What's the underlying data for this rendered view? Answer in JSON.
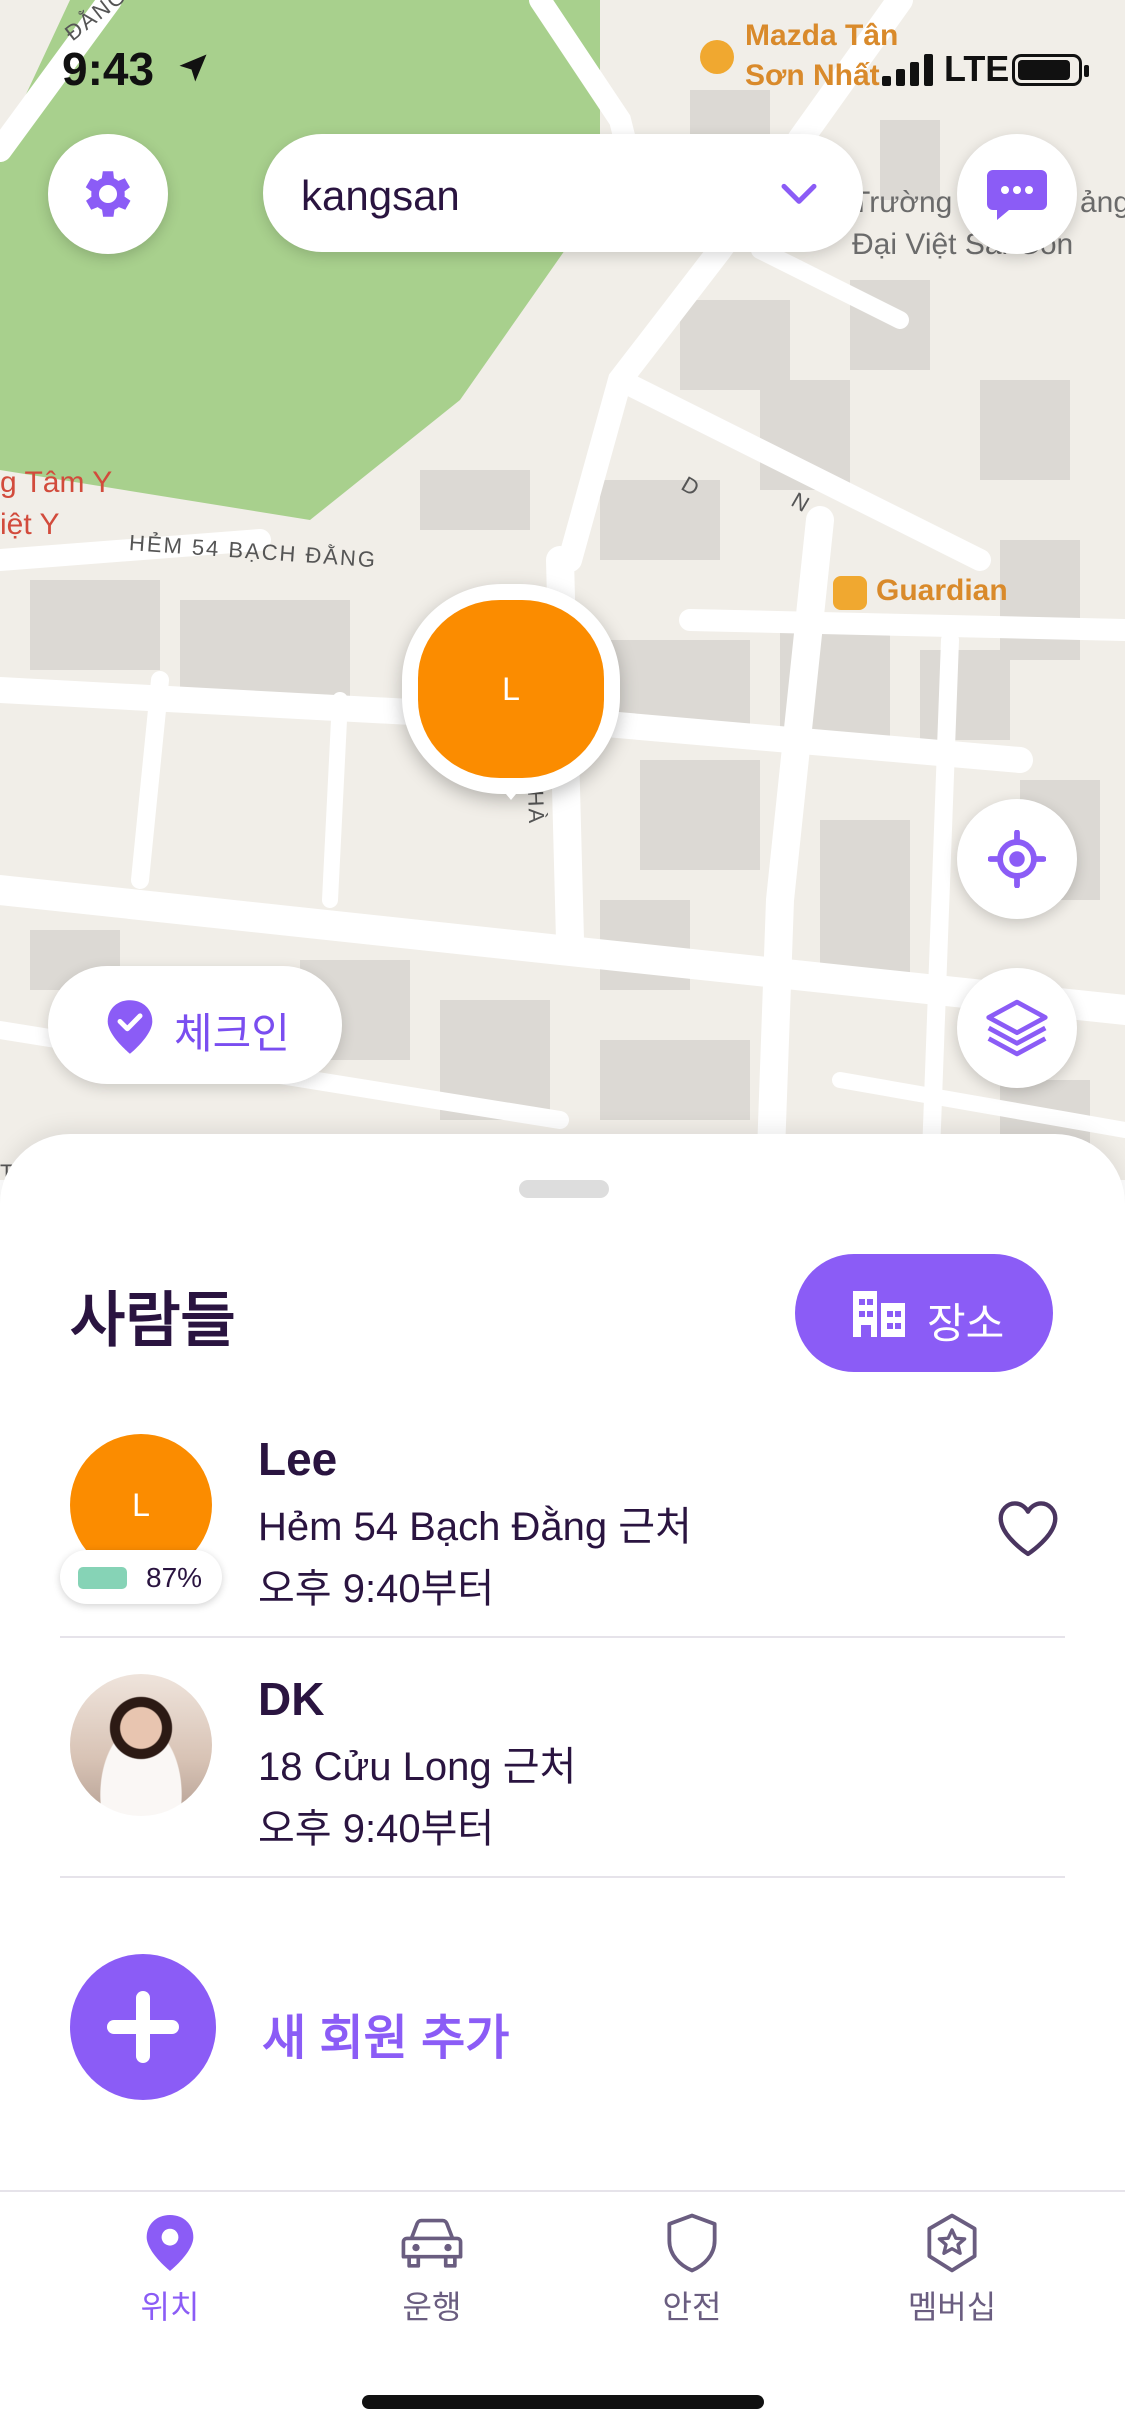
{
  "status_bar": {
    "time": "9:43",
    "network": "LTE"
  },
  "top_bar": {
    "circle_name": "kangsan"
  },
  "map": {
    "labels": {
      "mazda": "Mazda Tân\nSơn Nhất",
      "truong": "Trường",
      "truong_suffix": "ảng",
      "dai_viet": "Đại Việt Sài Gòn",
      "tam_y": "g Tâm Y",
      "viet_y": "iệt Y",
      "hem54": "HẺM 54 BẠCH ĐẰNG",
      "guardian": "Guardian",
      "road_d": "D",
      "road_n": "N",
      "road_ha": "HÀ",
      "dang": "ĐẰNG V",
      "corner_th": "TH"
    },
    "marker_initial": "L"
  },
  "checkin": {
    "label": "체크인"
  },
  "sheet": {
    "title": "사람들",
    "places_label": "장소",
    "members": [
      {
        "initial": "L",
        "name": "Lee",
        "address": "Hẻm 54 Bạch Đằng 근처",
        "since": "오후 9:40부터",
        "battery": "87%",
        "battery_level": 0.87
      },
      {
        "initial": "",
        "name": "DK",
        "address": "18 Cửu Long 근처",
        "since": "오후 9:40부터"
      }
    ],
    "add_member_label": "새 회원 추가"
  },
  "tabs": [
    {
      "label": "위치",
      "icon": "location-pin-icon",
      "active": true
    },
    {
      "label": "운행",
      "icon": "car-icon",
      "active": false
    },
    {
      "label": "안전",
      "icon": "shield-icon",
      "active": false
    },
    {
      "label": "멤버십",
      "icon": "star-badge-icon",
      "active": false
    }
  ],
  "colors": {
    "accent": "#8b5cf6",
    "avatar_orange": "#fb8c00",
    "park_green": "#a8d08d",
    "battery_green": "#86d3b6"
  }
}
